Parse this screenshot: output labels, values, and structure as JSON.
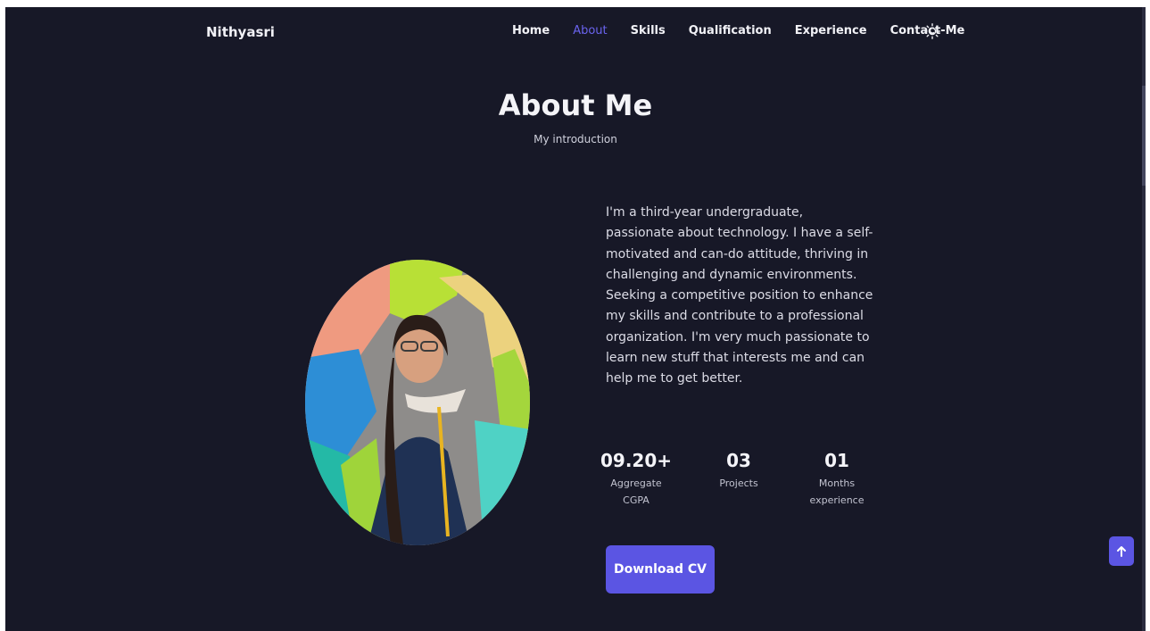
{
  "header": {
    "brand": "Nithyasri",
    "nav": [
      {
        "label": "Home"
      },
      {
        "label": "About",
        "active": true
      },
      {
        "label": "Skills"
      },
      {
        "label": "Qualification"
      },
      {
        "label": "Experience"
      },
      {
        "label": "Contact-Me"
      }
    ],
    "theme_icon": "sun-icon"
  },
  "about": {
    "title": "About Me",
    "subtitle": "My introduction",
    "description": "I'm a third-year undergraduate, passionate about technology. I have a self-motivated and can-do attitude, thriving in challenging and dynamic environments. Seeking a competitive position to enhance my skills and contribute to a professional organization. I'm very much passionate to learn new stuff that interests me and can help me to get better.",
    "stats": [
      {
        "value": "09.20+",
        "label_line1": "Aggregate",
        "label_line2": "CGPA"
      },
      {
        "value": "03",
        "label_line1": "Projects",
        "label_line2": ""
      },
      {
        "value": "01",
        "label_line1": "Months",
        "label_line2": "experience"
      }
    ],
    "download_label": "Download CV"
  },
  "scroll_up_icon": "arrow-up-icon",
  "colors": {
    "background": "#171827",
    "accent": "#5b55e3",
    "active_nav": "#6a63ee"
  }
}
